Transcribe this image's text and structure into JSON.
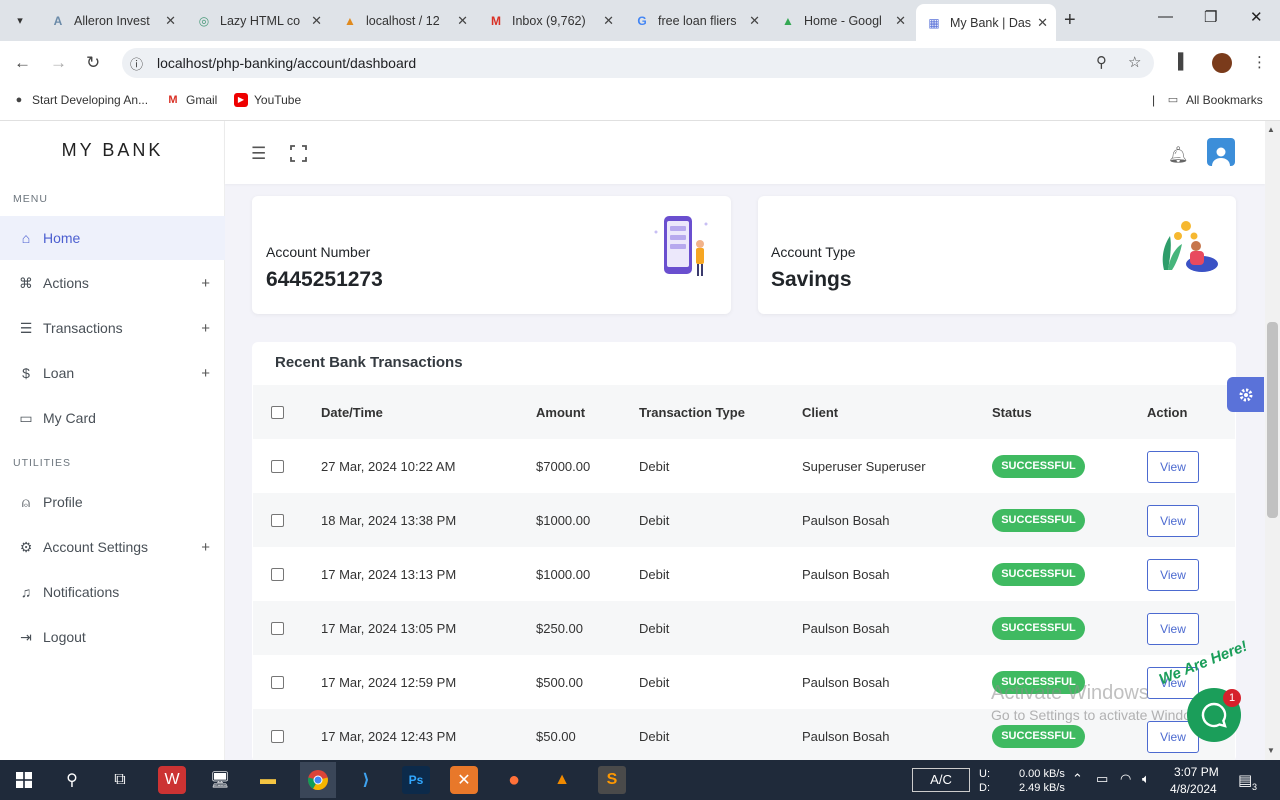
{
  "browser": {
    "tabs": [
      {
        "label": "Alleron Invest",
        "favicon": "A"
      },
      {
        "label": "Lazy HTML co",
        "favicon": "◎"
      },
      {
        "label": "localhost / 12",
        "favicon": "▲"
      },
      {
        "label": "Inbox (9,762)",
        "favicon": "M"
      },
      {
        "label": "free loan fliers",
        "favicon": "G"
      },
      {
        "label": "Home - Googl",
        "favicon": "▲"
      },
      {
        "label": "My Bank | Das",
        "favicon": "▦"
      }
    ],
    "url": "localhost/php-banking/account/dashboard",
    "bookmarks": [
      "Start Developing An...",
      "Gmail",
      "YouTube"
    ],
    "all_bookmarks": "All Bookmarks"
  },
  "sidebar": {
    "brand": "MY BANK",
    "menu_heading": "MENU",
    "utilities_heading": "UTILITIES",
    "menu_items": [
      {
        "label": "Home",
        "icon": "home-icon",
        "glyph": "⌂"
      },
      {
        "label": "Actions",
        "icon": "command-icon",
        "glyph": "⌘"
      },
      {
        "label": "Transactions",
        "icon": "list-icon",
        "glyph": "☰"
      },
      {
        "label": "Loan",
        "icon": "dollar-icon",
        "glyph": "$"
      },
      {
        "label": "My Card",
        "icon": "card-icon",
        "glyph": "▭"
      }
    ],
    "utility_items": [
      {
        "label": "Profile",
        "icon": "user-icon",
        "glyph": "⍝"
      },
      {
        "label": "Account Settings",
        "icon": "gear-icon",
        "glyph": "⚙"
      },
      {
        "label": "Notifications",
        "icon": "bell-icon",
        "glyph": "♫"
      },
      {
        "label": "Logout",
        "icon": "logout-icon",
        "glyph": "⇥"
      }
    ]
  },
  "cards": {
    "account_number_label": "Account Number",
    "account_number": "6445251273",
    "account_type_label": "Account Type",
    "account_type": "Savings"
  },
  "transactions": {
    "title": "Recent Bank Transactions",
    "headers": [
      "Date/Time",
      "Amount",
      "Transaction Type",
      "Client",
      "Status",
      "Action"
    ],
    "rows": [
      {
        "date": "27 Mar, 2024 10:22 AM",
        "amount": "$7000.00",
        "type": "Debit",
        "client": "Superuser Superuser",
        "status": "SUCCESSFUL",
        "action": "View"
      },
      {
        "date": "18 Mar, 2024 13:38 PM",
        "amount": "$1000.00",
        "type": "Debit",
        "client": "Paulson Bosah",
        "status": "SUCCESSFUL",
        "action": "View"
      },
      {
        "date": "17 Mar, 2024 13:13 PM",
        "amount": "$1000.00",
        "type": "Debit",
        "client": "Paulson Bosah",
        "status": "SUCCESSFUL",
        "action": "View"
      },
      {
        "date": "17 Mar, 2024 13:05 PM",
        "amount": "$250.00",
        "type": "Debit",
        "client": "Paulson Bosah",
        "status": "SUCCESSFUL",
        "action": "View"
      },
      {
        "date": "17 Mar, 2024 12:59 PM",
        "amount": "$500.00",
        "type": "Debit",
        "client": "Paulson Bosah",
        "status": "SUCCESSFUL",
        "action": "View"
      },
      {
        "date": "17 Mar, 2024 12:43 PM",
        "amount": "$50.00",
        "type": "Debit",
        "client": "Paulson Bosah",
        "status": "SUCCESSFUL",
        "action": "View"
      }
    ]
  },
  "overlay": {
    "watermark_title": "Activate Windows",
    "watermark_sub": "Go to Settings to activate Windows.",
    "chat_label": "We Are Here!",
    "chat_count": "1"
  },
  "taskbar": {
    "ac_label": "A/C",
    "net_u_label": "U:",
    "net_d_label": "D:",
    "net_up": "0.00 kB/s",
    "net_down": "2.49 kB/s",
    "time": "3:07 PM",
    "date": "4/8/2024",
    "notif_count": "3"
  },
  "colors": {
    "accent": "#4c6ad0",
    "success": "#3fba61",
    "chat": "#1b9e5a"
  }
}
